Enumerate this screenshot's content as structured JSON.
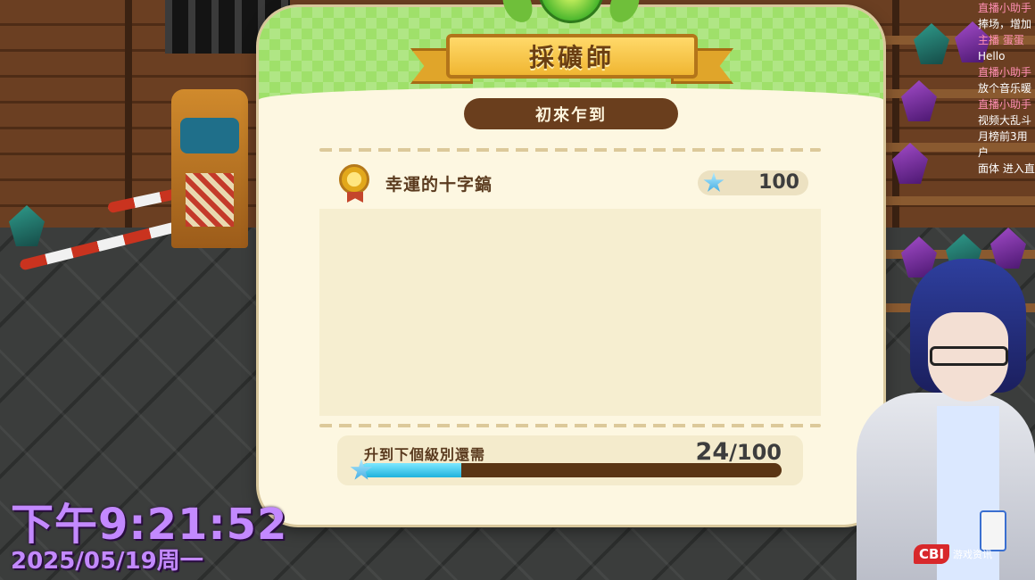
{
  "panel": {
    "title": "採礦師",
    "rank": "初來乍到",
    "reward": {
      "name": "幸運的十字鎬",
      "points": "100",
      "medal_icon": "medal-icon",
      "points_icon": "star-icon"
    },
    "progress": {
      "label": "升到下個級別還需",
      "current": "24",
      "separator": "/",
      "total": "100",
      "fraction": 0.24
    }
  },
  "overlay": {
    "clock_time": "下午9:21:52",
    "clock_date": "2025/05/19周一"
  },
  "chat": [
    {
      "name": "直播小助手",
      "text": "捧场，增加"
    },
    {
      "name": "主播 蛋蛋",
      "text": "Hello"
    },
    {
      "name": "直播小助手",
      "text": "放个音乐暖"
    },
    {
      "name": "直播小助手",
      "text": "视频大乱斗"
    },
    {
      "name": "",
      "text": "月榜前3用户"
    },
    {
      "name": "",
      "text": "面体 进入直"
    }
  ],
  "watermark": {
    "logo": "CBI",
    "sub": "游戏资讯"
  },
  "colors": {
    "accent_green": "#9fe06a",
    "ribbon_gold": "#f0b632",
    "rank_brown": "#6a3e1d",
    "progress_fill": "#1fb2dd",
    "clock_purple": "#c389ff"
  }
}
